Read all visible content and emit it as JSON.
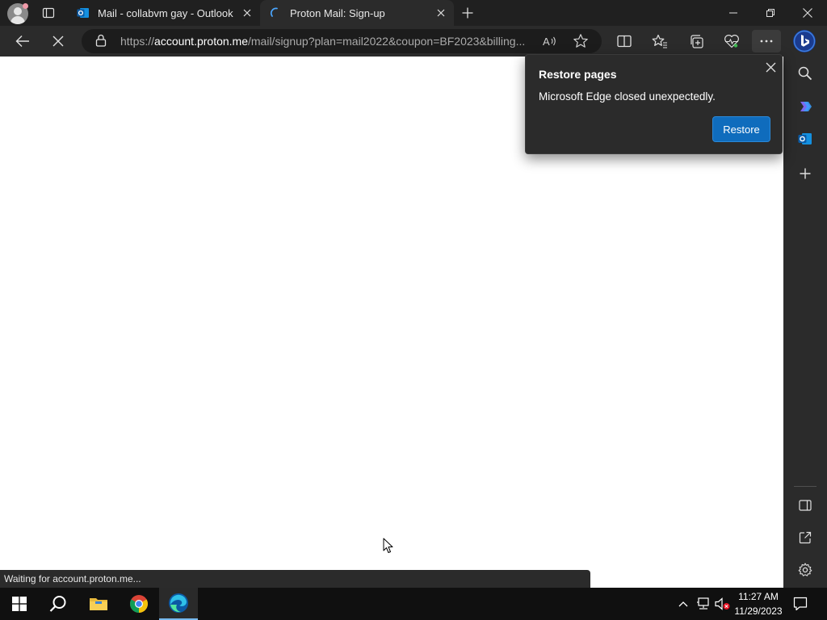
{
  "browser": {
    "tabs": [
      {
        "title": "Mail - collabvm gay - Outlook",
        "icon": "outlook-icon",
        "active": false
      },
      {
        "title": "Proton Mail: Sign-up",
        "icon": "loading-spinner-icon",
        "active": true
      }
    ],
    "address_bar": {
      "url_prefix": "https://",
      "url_host": "account.proton.me",
      "url_path": "/mail/signup?plan=mail2022&coupon=BF2023&billing..."
    },
    "status_text": "Waiting for account.proton.me..."
  },
  "popup": {
    "title": "Restore pages",
    "message": "Microsoft Edge closed unexpectedly.",
    "button_label": "Restore"
  },
  "taskbar": {
    "time": "11:27 AM",
    "date": "11/29/2023"
  },
  "colors": {
    "accent_button": "#0f6cbd",
    "chrome_dark": "#202020",
    "chrome_toolbar": "#2b2b2b"
  }
}
